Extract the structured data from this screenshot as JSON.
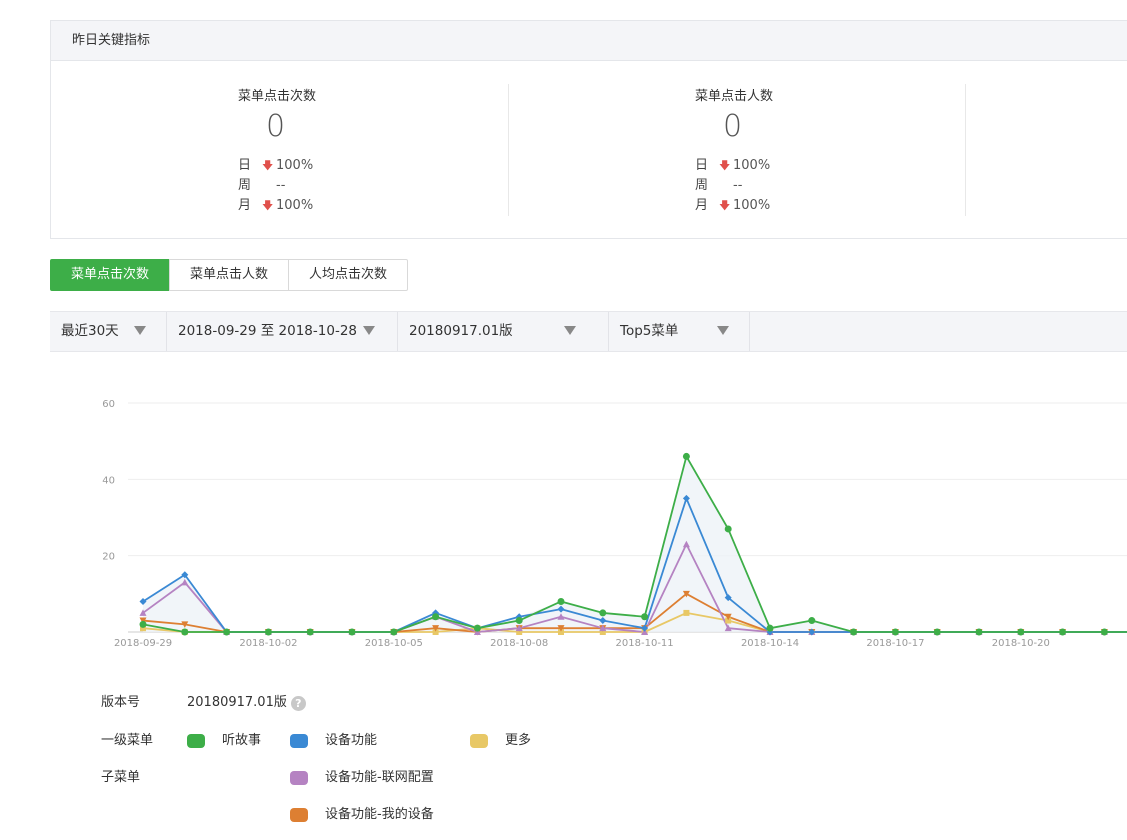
{
  "kpi": {
    "header": "昨日关键指标",
    "metrics": [
      {
        "title": "菜单点击次数",
        "value": "0",
        "rows": [
          {
            "label": "日",
            "arrow": "down",
            "value": "100%"
          },
          {
            "label": "周",
            "arrow": "",
            "value": "--"
          },
          {
            "label": "月",
            "arrow": "down",
            "value": "100%"
          }
        ]
      },
      {
        "title": "菜单点击人数",
        "value": "0",
        "rows": [
          {
            "label": "日",
            "arrow": "down",
            "value": "100%"
          },
          {
            "label": "周",
            "arrow": "",
            "value": "--"
          },
          {
            "label": "月",
            "arrow": "down",
            "value": "100%"
          }
        ]
      }
    ]
  },
  "tabs": [
    {
      "label": "菜单点击次数",
      "active": true
    },
    {
      "label": "菜单点击人数",
      "active": false
    },
    {
      "label": "人均点击次数",
      "active": false
    }
  ],
  "filters": {
    "range": "最近30天",
    "dates": "2018-09-29 至 2018-10-28",
    "version": "20180917.01版",
    "top": "Top5菜单"
  },
  "chart_data": {
    "type": "line",
    "x": [
      "2018-09-29",
      "2018-09-30",
      "2018-10-01",
      "2018-10-02",
      "2018-10-03",
      "2018-10-04",
      "2018-10-05",
      "2018-10-06",
      "2018-10-07",
      "2018-10-08",
      "2018-10-09",
      "2018-10-10",
      "2018-10-11",
      "2018-10-12",
      "2018-10-13",
      "2018-10-14",
      "2018-10-15",
      "2018-10-16",
      "2018-10-17",
      "2018-10-18",
      "2018-10-19",
      "2018-10-20",
      "2018-10-21",
      "2018-10-22",
      "2018-10-23"
    ],
    "x_tick_labels": [
      "2018-09-29",
      "2018-10-02",
      "2018-10-05",
      "2018-10-08",
      "2018-10-11",
      "2018-10-14",
      "2018-10-17",
      "2018-10-20"
    ],
    "ylim": [
      0,
      60
    ],
    "yticks": [
      20,
      40,
      60
    ],
    "grid": true,
    "series": [
      {
        "name": "听故事",
        "color": "#3dae48",
        "marker": "circle",
        "values": [
          2,
          0,
          0,
          0,
          0,
          0,
          0,
          4,
          1,
          3,
          8,
          5,
          4,
          46,
          27,
          1,
          3,
          0,
          0,
          0,
          0,
          0,
          0,
          0,
          0
        ]
      },
      {
        "name": "设备功能",
        "color": "#3a89d4",
        "marker": "diamond",
        "values": [
          8,
          15,
          0,
          0,
          0,
          0,
          0,
          5,
          1,
          4,
          6,
          3,
          1,
          35,
          9,
          0,
          0,
          0,
          0,
          0,
          0,
          0,
          0,
          0,
          0
        ]
      },
      {
        "name": "设备功能-联网配置",
        "color": "#b583c2",
        "marker": "triangle",
        "values": [
          5,
          13,
          0,
          0,
          0,
          0,
          0,
          4,
          0,
          1,
          4,
          1,
          0,
          23,
          1,
          0,
          0,
          0,
          0,
          0,
          0,
          0,
          0,
          0,
          0
        ]
      },
      {
        "name": "设备功能-我的设备",
        "color": "#dd7f32",
        "marker": "triangle-down",
        "values": [
          3,
          2,
          0,
          0,
          0,
          0,
          0,
          1,
          0,
          1,
          1,
          1,
          1,
          10,
          4,
          0,
          0,
          0,
          0,
          0,
          0,
          0,
          0,
          0,
          0
        ]
      },
      {
        "name": "更多",
        "color": "#e8c866",
        "marker": "square",
        "values": [
          1,
          0,
          0,
          0,
          0,
          0,
          0,
          0,
          1,
          0,
          0,
          0,
          0,
          5,
          3,
          0,
          0,
          0,
          0,
          0,
          0,
          0,
          0,
          0,
          0
        ]
      }
    ]
  },
  "legend": {
    "version_label": "版本号",
    "version_value": "20180917.01版",
    "level1_label": "一级菜单",
    "sub_label": "子菜单",
    "items": {
      "gushi": {
        "name": "听故事",
        "color": "#3dae48"
      },
      "shebei": {
        "name": "设备功能",
        "color": "#3a89d4"
      },
      "gengduo": {
        "name": "更多",
        "color": "#e8c866"
      },
      "lianwang": {
        "name": "设备功能-联网配置",
        "color": "#b583c2"
      },
      "wode": {
        "name": "设备功能-我的设备",
        "color": "#dd7f32"
      }
    }
  }
}
